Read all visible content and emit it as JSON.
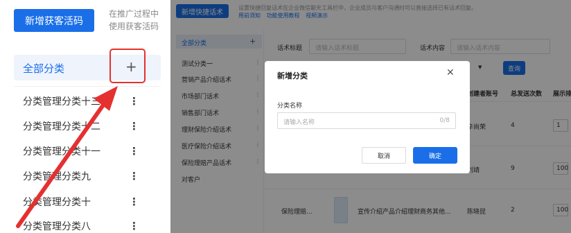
{
  "left_panel": {
    "new_button_label": "新增获客活码",
    "description_lines": [
      "在推广过程中",
      "使用获客活码"
    ],
    "all_category_label": "全部分类",
    "add_symbol": "+",
    "items": [
      "分类管理分类十三",
      "分类管理分类十二",
      "分类管理分类十一",
      "分类管理分类九",
      "分类管理分类十",
      "分类管理分类八"
    ],
    "more_symbol": "⋮"
  },
  "app": {
    "new_script_button": "新增快捷话术",
    "tip_text": "设置快捷回复话术在企业微信聊天工具栏中，企业成员与客户沟通时可以直接选择已有话术回复。",
    "tip_links": [
      "用前须知",
      "功能使用教程",
      "视频演示"
    ],
    "sidebar": {
      "all_label": "全部分类",
      "add_symbol": "+",
      "items": [
        "测试分类一",
        "营销产品介绍话术",
        "市场部门话术",
        "销售部门话术",
        "理财保险介绍话术",
        "医疗保险介绍话术",
        "保险理赔产品话术",
        "对客户"
      ],
      "more_symbol": "⋮"
    },
    "filters": {
      "title_label": "话术标题",
      "title_placeholder": "请输入话术标题",
      "content_label": "话术内容",
      "content_placeholder": "请输入话术内容",
      "search_button": "查询"
    },
    "table": {
      "headers": [
        "创建者账号",
        "总发送次数",
        "展示排序"
      ],
      "rows": [
        {
          "creator": "辛尚荣",
          "count": "4",
          "order": "1"
        },
        {
          "creator": "刘靖",
          "count": "9",
          "order": "100"
        },
        {
          "title": "保险理赔...",
          "desc": "宣传介绍产品介绍理财商务其他...",
          "creator": "陈晓昆",
          "count": "2",
          "order": "100"
        }
      ]
    }
  },
  "modal": {
    "title": "新增分类",
    "close_symbol": "✕",
    "field_label": "分类名称",
    "input_placeholder": "请输入名称",
    "char_count": "0/8",
    "cancel_label": "取消",
    "confirm_label": "确定"
  },
  "colors": {
    "primary": "#1a6fe8",
    "highlight_red": "#e53030",
    "mask": "rgba(0,0,0,0.45)"
  }
}
